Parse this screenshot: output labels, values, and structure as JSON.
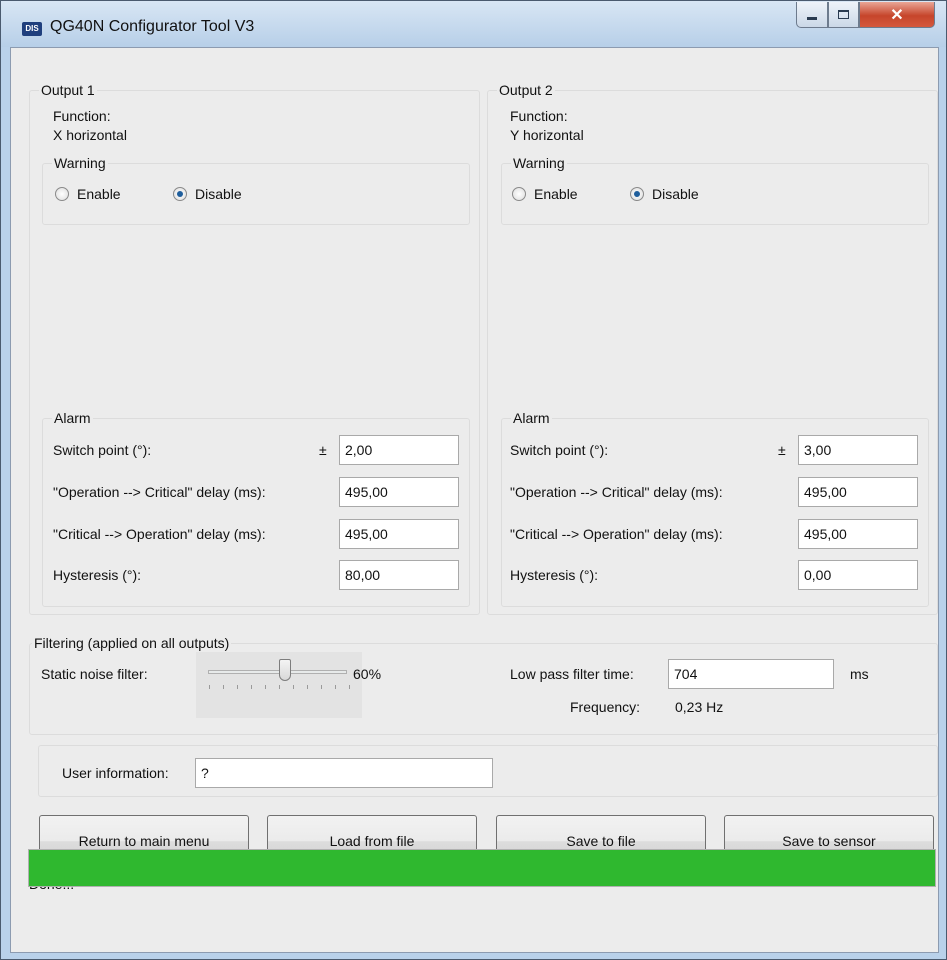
{
  "window": {
    "title": "QG40N Configurator Tool V3",
    "icon_text": "DIS",
    "controls": [
      "minimize-icon",
      "maximize-icon",
      "close-icon"
    ]
  },
  "output1": {
    "title": "Output 1",
    "function_label": "Function:",
    "function_value": "X horizontal",
    "warning": {
      "title": "Warning",
      "enable_label": "Enable",
      "disable_label": "Disable",
      "selected": "Disable"
    },
    "alarm": {
      "title": "Alarm",
      "switch_point_label": "Switch point (°):",
      "plus_minus": "±",
      "switch_point_value": "2,00",
      "op_to_crit_label": "\"Operation --> Critical\" delay (ms):",
      "op_to_crit_value": "495,00",
      "crit_to_op_label": "\"Critical --> Operation\" delay (ms):",
      "crit_to_op_value": "495,00",
      "hysteresis_label": "Hysteresis (°):",
      "hysteresis_value": "80,00"
    }
  },
  "output2": {
    "title": "Output 2",
    "function_label": "Function:",
    "function_value": "Y horizontal",
    "warning": {
      "title": "Warning",
      "enable_label": "Enable",
      "disable_label": "Disable",
      "selected": "Disable"
    },
    "alarm": {
      "title": "Alarm",
      "switch_point_label": "Switch point (°):",
      "plus_minus": "±",
      "switch_point_value": "3,00",
      "op_to_crit_label": "\"Operation --> Critical\" delay (ms):",
      "op_to_crit_value": "495,00",
      "crit_to_op_label": "\"Critical --> Operation\" delay (ms):",
      "crit_to_op_value": "495,00",
      "hysteresis_label": "Hysteresis (°):",
      "hysteresis_value": "0,00"
    }
  },
  "filtering": {
    "title": "Filtering (applied on all outputs)",
    "static_noise_label": "Static noise filter:",
    "static_noise_value": "60%",
    "low_pass_label": "Low pass filter time:",
    "low_pass_value": "704",
    "low_pass_unit": "ms",
    "frequency_label": "Frequency:",
    "frequency_value": "0,23 Hz"
  },
  "user_info": {
    "label": "User information:",
    "value": "?"
  },
  "buttons": {
    "return_main_menu": "Return to main menu",
    "load_from_file": "Load from file",
    "save_to_file": "Save to file",
    "save_to_sensor": "Save to sensor"
  },
  "status": {
    "text": "Done...",
    "progress_fraction": 1.0,
    "progress_color": "#2fb82f"
  }
}
